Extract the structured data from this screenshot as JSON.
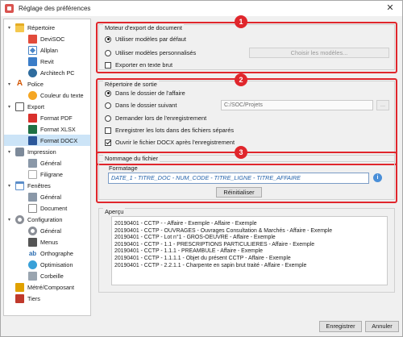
{
  "window": {
    "title": "Réglage des préférences",
    "close_glyph": "✕"
  },
  "sidebar": {
    "items": [
      {
        "label": "Répertoire",
        "icon": "folder-icon",
        "level": 0,
        "expanded": true
      },
      {
        "label": "DeviSOC",
        "icon": "devisoc-icon",
        "level": 1
      },
      {
        "label": "Allplan",
        "icon": "allplan-icon",
        "level": 1
      },
      {
        "label": "Revit",
        "icon": "revit-icon",
        "level": 1
      },
      {
        "label": "Architech PC",
        "icon": "architech-icon",
        "level": 1
      },
      {
        "label": "Police",
        "icon": "font-icon",
        "level": 0,
        "expanded": true
      },
      {
        "label": "Couleur du texte",
        "icon": "palette-icon",
        "level": 1
      },
      {
        "label": "Export",
        "icon": "export-icon",
        "level": 0,
        "expanded": true
      },
      {
        "label": "Format PDF",
        "icon": "pdf-icon",
        "level": 1
      },
      {
        "label": "Format XLSX",
        "icon": "xlsx-icon",
        "level": 1
      },
      {
        "label": "Format DOCX",
        "icon": "docx-icon",
        "level": 1,
        "selected": true
      },
      {
        "label": "Impression",
        "icon": "printer-icon",
        "level": 0,
        "expanded": true
      },
      {
        "label": "Général",
        "icon": "general-icon",
        "level": 1
      },
      {
        "label": "Filigrane",
        "icon": "watermark-icon",
        "level": 1
      },
      {
        "label": "Fenêtres",
        "icon": "window-icon",
        "level": 0,
        "expanded": true
      },
      {
        "label": "Général",
        "icon": "general-icon",
        "level": 1
      },
      {
        "label": "Document",
        "icon": "document-icon",
        "level": 1
      },
      {
        "label": "Configuration",
        "icon": "gear-icon",
        "level": 0,
        "expanded": true
      },
      {
        "label": "Général",
        "icon": "gear-icon",
        "level": 1
      },
      {
        "label": "Menus",
        "icon": "menu-icon",
        "level": 1
      },
      {
        "label": "Orthographe",
        "icon": "spellcheck-icon",
        "level": 1
      },
      {
        "label": "Optimisation",
        "icon": "optimization-icon",
        "level": 1
      },
      {
        "label": "Corbeille",
        "icon": "trash-icon",
        "level": 1
      },
      {
        "label": "Métré/Composant",
        "icon": "metre-icon",
        "level": 0
      },
      {
        "label": "Tiers",
        "icon": "tiers-icon",
        "level": 0
      }
    ]
  },
  "export_engine": {
    "title": "Moteur d'export de document",
    "badge": "1",
    "options": [
      {
        "label": "Utiliser modèles par défaut",
        "selected": true
      },
      {
        "label": "Utiliser modèles personnalisés",
        "selected": false
      }
    ],
    "choose_button": "Choisir les modèles...",
    "plain_text_label": "Exporter en texte brut",
    "plain_text_checked": false
  },
  "output_dir": {
    "title": "Répertoire de sortie",
    "badge": "2",
    "options": [
      {
        "label": "Dans le dossier de l'affaire",
        "selected": true
      },
      {
        "label": "Dans le dossier suivant",
        "selected": false
      },
      {
        "label": "Demander lors de l'enregistrement",
        "selected": false
      }
    ],
    "path_value": "C:/SOC/Projets",
    "browse_button": "...",
    "save_separately_label": "Enregistrer les lots dans des fichiers séparés",
    "save_separately_checked": false,
    "open_after_label": "Ouvrir le fichier DOCX après l'enregistrement",
    "open_after_checked": true
  },
  "file_naming": {
    "title": "Nommage du fichier",
    "badge": "3",
    "format_label": "Formatage",
    "format_value": "DATE_1 - TITRE_DOC - NUM_CODE - TITRE_LIGNE - TITRE_AFFAIRE",
    "info_glyph": "i",
    "reset_button": "Réinitialiser"
  },
  "preview": {
    "title": "Aperçu",
    "lines": [
      "20190401 - CCTP -  - Affaire - Exemple - Affaire - Exemple",
      "20190401 - CCTP - OUVRAGES - Ouvrages Consultation & Marchés - Affaire - Exemple",
      "20190401 - CCTP - Lot n°1 - GROS-OEUVRE - Affaire - Exemple",
      "20190401 - CCTP - 1.1 - PRESCRIPTIONS  PARTICULIERES - Affaire - Exemple",
      "20190401 - CCTP - 1.1.1 - PREAMBULE - Affaire - Exemple",
      "20190401 - CCTP - 1.1.1.1 - Objet du présent CCTP - Affaire - Exemple",
      "20190401 - CCTP - 2.2.1.1 - Charpente en sapin brut traité - Affaire - Exemple"
    ]
  },
  "footer": {
    "save_button": "Enregistrer",
    "cancel_button": "Annuler"
  }
}
